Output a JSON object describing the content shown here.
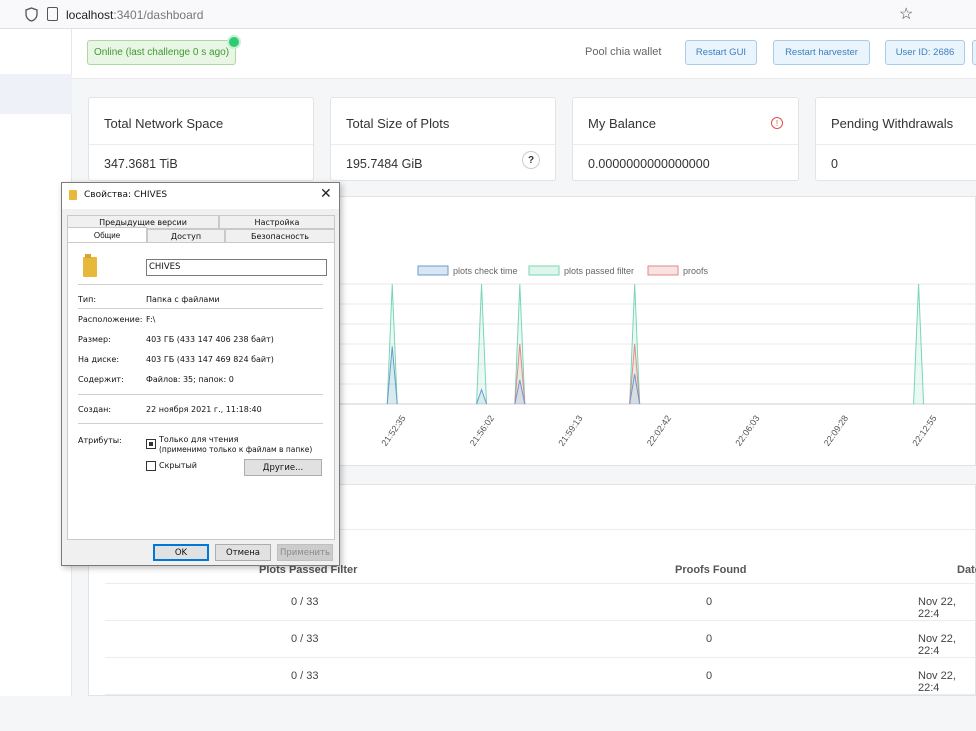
{
  "browser": {
    "url_host": "localhost",
    "url_path": ":3401/dashboard"
  },
  "topbar": {
    "status": "Online (last challenge 0 s ago)",
    "wallet_label": "Pool chia wallet",
    "restart_gui": "Restart GUI",
    "restart_harvester": "Restart harvester",
    "user_id": "User ID: 2686"
  },
  "cards": [
    {
      "title": "Total Network Space",
      "value": "347.3681 TiB"
    },
    {
      "title": "Total Size of Plots",
      "value": "195.7484 GiB"
    },
    {
      "title": "My Balance",
      "value": "0.0000000000000000"
    },
    {
      "title": "Pending Withdrawals",
      "value": "0"
    }
  ],
  "chart_data": {
    "type": "line",
    "legend": [
      "plots check time",
      "plots passed filter",
      "proofs"
    ],
    "colors": {
      "check": "#6a9bd0",
      "filter": "#7ad6b3",
      "proofs": "#e28a8a"
    },
    "x_ticks": [
      "21:52:35",
      "21:56:02",
      "21:59:13",
      "22:02:42",
      "22:06:03",
      "22:09:28",
      "22:12:55"
    ],
    "spikes": [
      {
        "x": 0.085,
        "check": 0.48,
        "filter": 1.0,
        "proofs": 0
      },
      {
        "x": 0.225,
        "check": 0.12,
        "filter": 1.0,
        "proofs": 0
      },
      {
        "x": 0.285,
        "check": 0.2,
        "filter": 1.0,
        "proofs": 0.5
      },
      {
        "x": 0.465,
        "check": 0.25,
        "filter": 1.0,
        "proofs": 0.5
      },
      {
        "x": 0.91,
        "check": 0,
        "filter": 1.0,
        "proofs": 0
      }
    ]
  },
  "table": {
    "headers": [
      "Plots Passed Filter",
      "Proofs Found",
      "Date"
    ],
    "rows": [
      [
        "0 / 33",
        "0",
        "Nov 22, 22:4"
      ],
      [
        "0 / 33",
        "0",
        "Nov 22, 22:4"
      ],
      [
        "0 / 33",
        "0",
        "Nov 22, 22:4"
      ]
    ]
  },
  "dialog": {
    "title": "Свойства: CHIVES",
    "tabs_top": [
      "Предыдущие версии",
      "Настройка"
    ],
    "tabs_bottom": [
      "Общие",
      "Доступ",
      "Безопасность"
    ],
    "name": "CHIVES",
    "type_label": "Тип:",
    "type_value": "Папка с файлами",
    "location_label": "Расположение:",
    "location_value": "F:\\",
    "size_label": "Размер:",
    "size_value": "403 ГБ (433 147 406 238 байт)",
    "disk_label": "На диске:",
    "disk_value": "403 ГБ (433 147 469 824 байт)",
    "contains_label": "Содержит:",
    "contains_value": "Файлов: 35; папок: 0",
    "created_label": "Создан:",
    "created_value": "22 ноября 2021 г., 11:18:40",
    "attributes_label": "Атрибуты:",
    "readonly_label": "Только для чтения",
    "readonly_note": "(применимо только к файлам в папке)",
    "hidden_label": "Скрытый",
    "other_button": "Другие...",
    "ok": "OK",
    "cancel": "Отмена",
    "apply": "Применить"
  }
}
